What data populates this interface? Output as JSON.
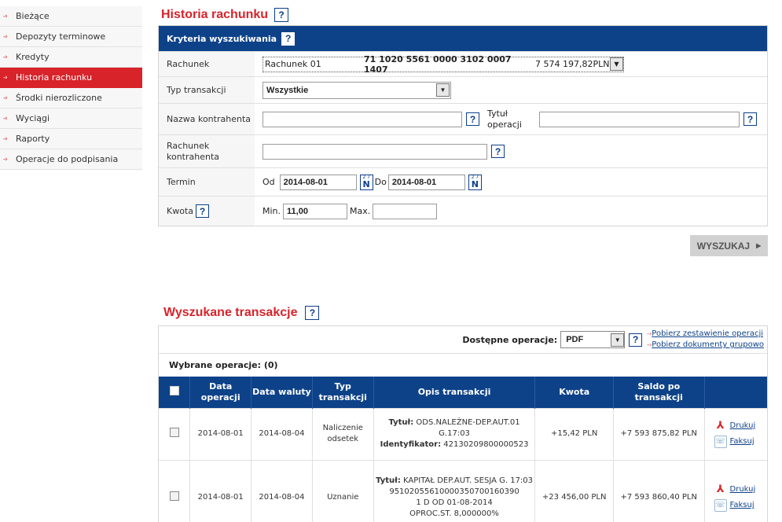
{
  "sidebar": {
    "items": [
      {
        "label": "Bieżące",
        "active": false
      },
      {
        "label": "Depozyty terminowe",
        "active": false
      },
      {
        "label": "Kredyty",
        "active": false
      },
      {
        "label": "Historia rachunku",
        "active": true
      },
      {
        "label": "Środki nierozliczone",
        "active": false
      },
      {
        "label": "Wyciągi",
        "active": false
      },
      {
        "label": "Raporty",
        "active": false
      },
      {
        "label": "Operacje do podpisania",
        "active": false
      }
    ]
  },
  "page": {
    "title": "Historia rachunku",
    "help": "?"
  },
  "criteria": {
    "header": "Kryteria wyszukiwania",
    "account_label": "Rachunek",
    "account_name": "Rachunek 01",
    "account_number": "71 1020 5561 0000 3102 0007 1407",
    "account_balance": "7 574 197,82PLN",
    "type_label": "Typ transakcji",
    "type_value": "Wszystkie",
    "contractor_label": "Nazwa kontrahenta",
    "contractor_value": "",
    "title_label": "Tytuł operacji",
    "title_value": "",
    "contractor_account_label": "Rachunek kontrahenta",
    "contractor_account_value": "",
    "term_label": "Termin",
    "from_label": "Od",
    "from_value": "2014-08-01",
    "to_label": "Do",
    "to_value": "2014-08-01",
    "amount_label": "Kwota",
    "min_label": "Min.",
    "min_value": "11,00",
    "max_label": "Max.",
    "max_value": "",
    "calendar_top": "2 7",
    "calendar_letter": "N"
  },
  "search_button": "WYSZUKAJ",
  "results": {
    "title": "Wyszukane transakcje",
    "ops_label": "Dostępne operacje:",
    "ops_value": "PDF",
    "link1": "Pobierz zestawienie operacji",
    "link2": "Pobierz dokumenty grupowo",
    "selected": "Wybrane operacje: (0)",
    "columns": [
      "Data operacji",
      "Data waluty",
      "Typ transakcji",
      "Opis transakcji",
      "Kwota",
      "Saldo po transakcji"
    ],
    "rows": [
      {
        "op_date": "2014-08-01",
        "val_date": "2014-08-04",
        "type": "Naliczenie odsetek",
        "title_label": "Tytuł:",
        "title": "ODS.NALEŻNE-DEP.AUT.01 G.17:03",
        "id_label": "Identyfikator:",
        "id": "42130209800000523",
        "amount": "+15,42 PLN",
        "balance": "+7 593 875,82 PLN"
      },
      {
        "op_date": "2014-08-01",
        "val_date": "2014-08-04",
        "type": "Uznanie",
        "title_label": "Tytuł:",
        "title": "KAPITAŁ DEP.AUT. SESJA G. 17:03",
        "line2": "95102055610000350700160390",
        "line3": "1 D OD 01-08-2014",
        "line4": "OPROC.ST. 8,000000%",
        "amount": "+23 456,00 PLN",
        "balance": "+7 593 860,40 PLN"
      }
    ],
    "print": "Drukuj",
    "fax": "Faksuj"
  }
}
